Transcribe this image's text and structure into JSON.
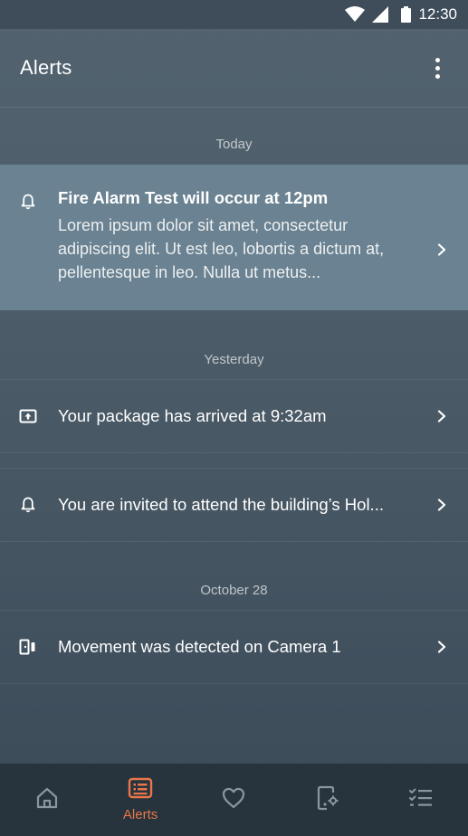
{
  "status_bar": {
    "time": "12:30",
    "icons": [
      "wifi-icon",
      "signal-icon",
      "battery-icon"
    ]
  },
  "app_bar": {
    "title": "Alerts",
    "menu_icon": "more-vert-icon"
  },
  "sections": [
    {
      "label": "Today",
      "items": [
        {
          "icon": "bell-icon",
          "title": "Fire Alarm Test will occur at 12pm",
          "description": "Lorem ipsum dolor sit amet, consectetur adipiscing elit. Ut est leo, lobortis a dictum at, pellentesque in leo. Nulla ut metus..."
        }
      ]
    },
    {
      "label": "Yesterday",
      "items": [
        {
          "icon": "package-icon",
          "title": "Your package has arrived at 9:32am"
        },
        {
          "icon": "bell-icon",
          "title": "You are invited to attend the building’s Hol..."
        }
      ]
    },
    {
      "label": "October 28",
      "items": [
        {
          "icon": "door-sensor-icon",
          "title": "Movement was detected on Camera 1"
        }
      ]
    }
  ],
  "bottom_nav": {
    "items": [
      {
        "icon": "home-icon",
        "label": ""
      },
      {
        "icon": "alerts-list-icon",
        "label": "Alerts",
        "active": true
      },
      {
        "icon": "heart-icon",
        "label": ""
      },
      {
        "icon": "device-settings-icon",
        "label": ""
      },
      {
        "icon": "checklist-icon",
        "label": ""
      }
    ],
    "active_color": "#e8764a",
    "inactive_color": "#8a97a1"
  },
  "colors": {
    "highlight_row": "#6a8291",
    "nav_background": "#27333d",
    "accent": "#e8764a"
  }
}
